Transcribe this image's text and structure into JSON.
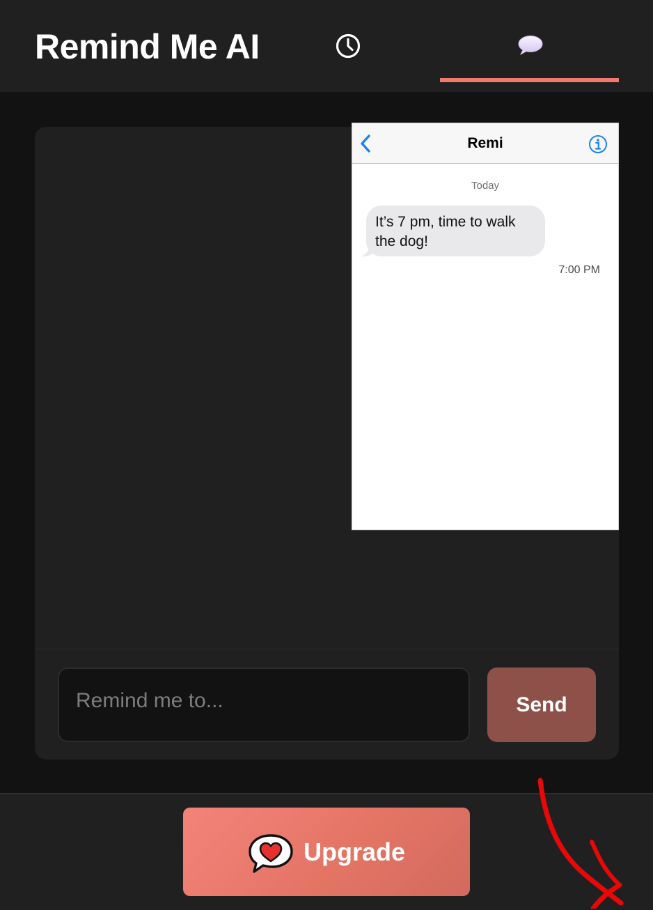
{
  "header": {
    "app_title": "Remind Me AI",
    "tabs": [
      {
        "icon": "clock-icon",
        "active": false
      },
      {
        "icon": "speech-bubble-icon",
        "active": true
      }
    ]
  },
  "colors": {
    "accent": "#f07a6e",
    "send_button": "#8e5149",
    "background": "#121212",
    "panel": "#202020",
    "ios_blue": "#1a82fb"
  },
  "phone_preview": {
    "contact_name": "Remi",
    "date_label": "Today",
    "message_text": "It’s 7 pm, time to walk the dog!",
    "message_time": "7:00 PM"
  },
  "composer": {
    "placeholder": "Remind me to...",
    "value": "",
    "send_label": "Send"
  },
  "footer": {
    "upgrade_label": "Upgrade",
    "upgrade_icon": "heart-speech-bubble-icon"
  }
}
